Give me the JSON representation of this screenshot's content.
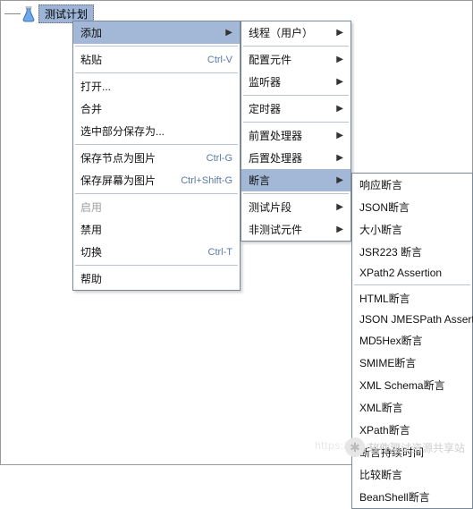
{
  "tree": {
    "label": "测试计划"
  },
  "menu1": {
    "groups": [
      [
        {
          "label": "添加",
          "arrow": true,
          "highlight": true
        }
      ],
      [
        {
          "label": "粘贴",
          "shortcut": "Ctrl-V"
        }
      ],
      [
        {
          "label": "打开..."
        },
        {
          "label": "合并"
        },
        {
          "label": "选中部分保存为..."
        }
      ],
      [
        {
          "label": "保存节点为图片",
          "shortcut": "Ctrl-G"
        },
        {
          "label": "保存屏幕为图片",
          "shortcut": "Ctrl+Shift-G"
        }
      ],
      [
        {
          "label": "启用",
          "disabled": true
        },
        {
          "label": "禁用"
        },
        {
          "label": "切换",
          "shortcut": "Ctrl-T"
        }
      ],
      [
        {
          "label": "帮助"
        }
      ]
    ]
  },
  "menu2": {
    "groups": [
      [
        {
          "label": "线程（用户）",
          "arrow": true
        }
      ],
      [
        {
          "label": "配置元件",
          "arrow": true
        },
        {
          "label": "监听器",
          "arrow": true
        }
      ],
      [
        {
          "label": "定时器",
          "arrow": true
        }
      ],
      [
        {
          "label": "前置处理器",
          "arrow": true
        },
        {
          "label": "后置处理器",
          "arrow": true
        },
        {
          "label": "断言",
          "arrow": true,
          "highlight": true
        }
      ],
      [
        {
          "label": "测试片段",
          "arrow": true
        },
        {
          "label": "非测试元件",
          "arrow": true
        }
      ]
    ]
  },
  "menu3": {
    "groups": [
      [
        {
          "label": "响应断言"
        },
        {
          "label": "JSON断言"
        },
        {
          "label": "大小断言"
        },
        {
          "label": "JSR223 断言"
        },
        {
          "label": "XPath2 Assertion"
        }
      ],
      [
        {
          "label": "HTML断言"
        },
        {
          "label": "JSON JMESPath Assertion"
        },
        {
          "label": "MD5Hex断言"
        },
        {
          "label": "SMIME断言"
        },
        {
          "label": "XML Schema断言"
        },
        {
          "label": "XML断言"
        },
        {
          "label": "XPath断言"
        },
        {
          "label": "断言持续时间"
        },
        {
          "label": "比较断言"
        },
        {
          "label": "BeanShell断言"
        }
      ]
    ]
  },
  "watermark": {
    "text": "软件测试资源共享站",
    "url": "https://blog.csdn"
  }
}
